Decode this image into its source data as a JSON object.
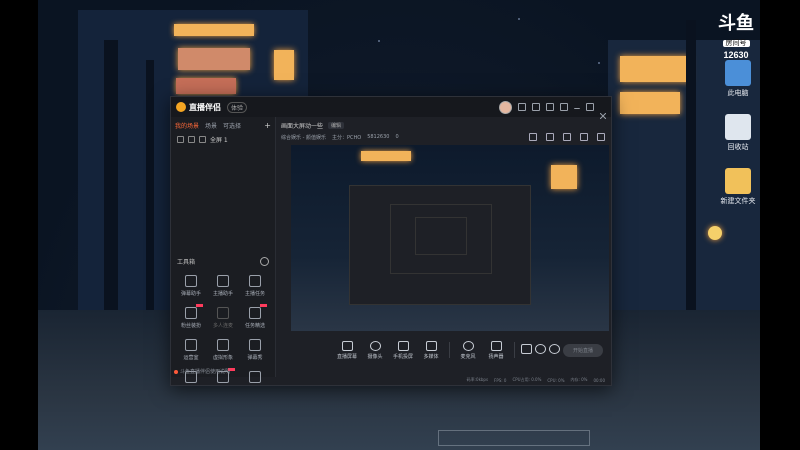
{
  "watermark": {
    "logo": "斗鱼",
    "badge": "房间号",
    "room": "12630"
  },
  "desktop_icons": [
    {
      "label": "此电脑",
      "icon": "monitor-icon"
    },
    {
      "label": "回收站",
      "icon": "recycle-bin-icon"
    },
    {
      "label": "新建文件夹",
      "icon": "folder-icon"
    }
  ],
  "app": {
    "name": "直播伴侣",
    "tag": "体验",
    "tabs": [
      "我的场景",
      "场景",
      "可选择"
    ],
    "scene_item": "全屏 1",
    "room_title": "画面大屏动一些",
    "room_title_tag": "编辑",
    "meta": [
      "综合娱乐 - 颜值娱乐",
      "主分：PCHO",
      "5812630",
      "0"
    ],
    "tools_header": "工具箱",
    "tools": [
      {
        "label": "弹幕助手",
        "icon": "danmaku-icon",
        "dim": false,
        "tag": false
      },
      {
        "label": "主播助手",
        "icon": "helper-icon",
        "dim": false,
        "tag": false
      },
      {
        "label": "主播任务",
        "icon": "task-icon",
        "dim": false,
        "tag": false
      },
      {
        "label": "粉丝装扮",
        "icon": "fans-icon",
        "dim": false,
        "tag": true
      },
      {
        "label": "多人连麦",
        "icon": "co-stream-icon",
        "dim": true,
        "tag": false
      },
      {
        "label": "任务精选",
        "icon": "featured-icon",
        "dim": false,
        "tag": true
      },
      {
        "label": "运营室",
        "icon": "operation-icon",
        "dim": false,
        "tag": false
      },
      {
        "label": "虚拟形象",
        "icon": "avatar-icon",
        "dim": false,
        "tag": false
      },
      {
        "label": "弹幕秀",
        "icon": "show-icon",
        "dim": false,
        "tag": false
      },
      {
        "label": "",
        "icon": "more-a-icon",
        "dim": false,
        "tag": false
      },
      {
        "label": "",
        "icon": "more-b-icon",
        "dim": false,
        "tag": true
      },
      {
        "label": "",
        "icon": "more-c-icon",
        "dim": false,
        "tag": false
      }
    ],
    "hint": "斗鱼直播伴侣使用说明",
    "bottom_tools": [
      {
        "label": "直播屏幕",
        "icon": "screen-icon"
      },
      {
        "label": "摄像头",
        "icon": "camera-icon"
      },
      {
        "label": "手机投屏",
        "icon": "phone-icon"
      },
      {
        "label": "多媒体",
        "icon": "media-icon"
      },
      {
        "label": "麦克风",
        "icon": "mic-icon"
      },
      {
        "label": "扬声器",
        "icon": "speaker-icon"
      }
    ],
    "start_label": "开始直播",
    "status": [
      "码率:0kbps",
      "FPS: 0",
      "CPU占用: 0.0%",
      "CPU: 0%",
      "内存: 0%",
      "00:00"
    ]
  }
}
